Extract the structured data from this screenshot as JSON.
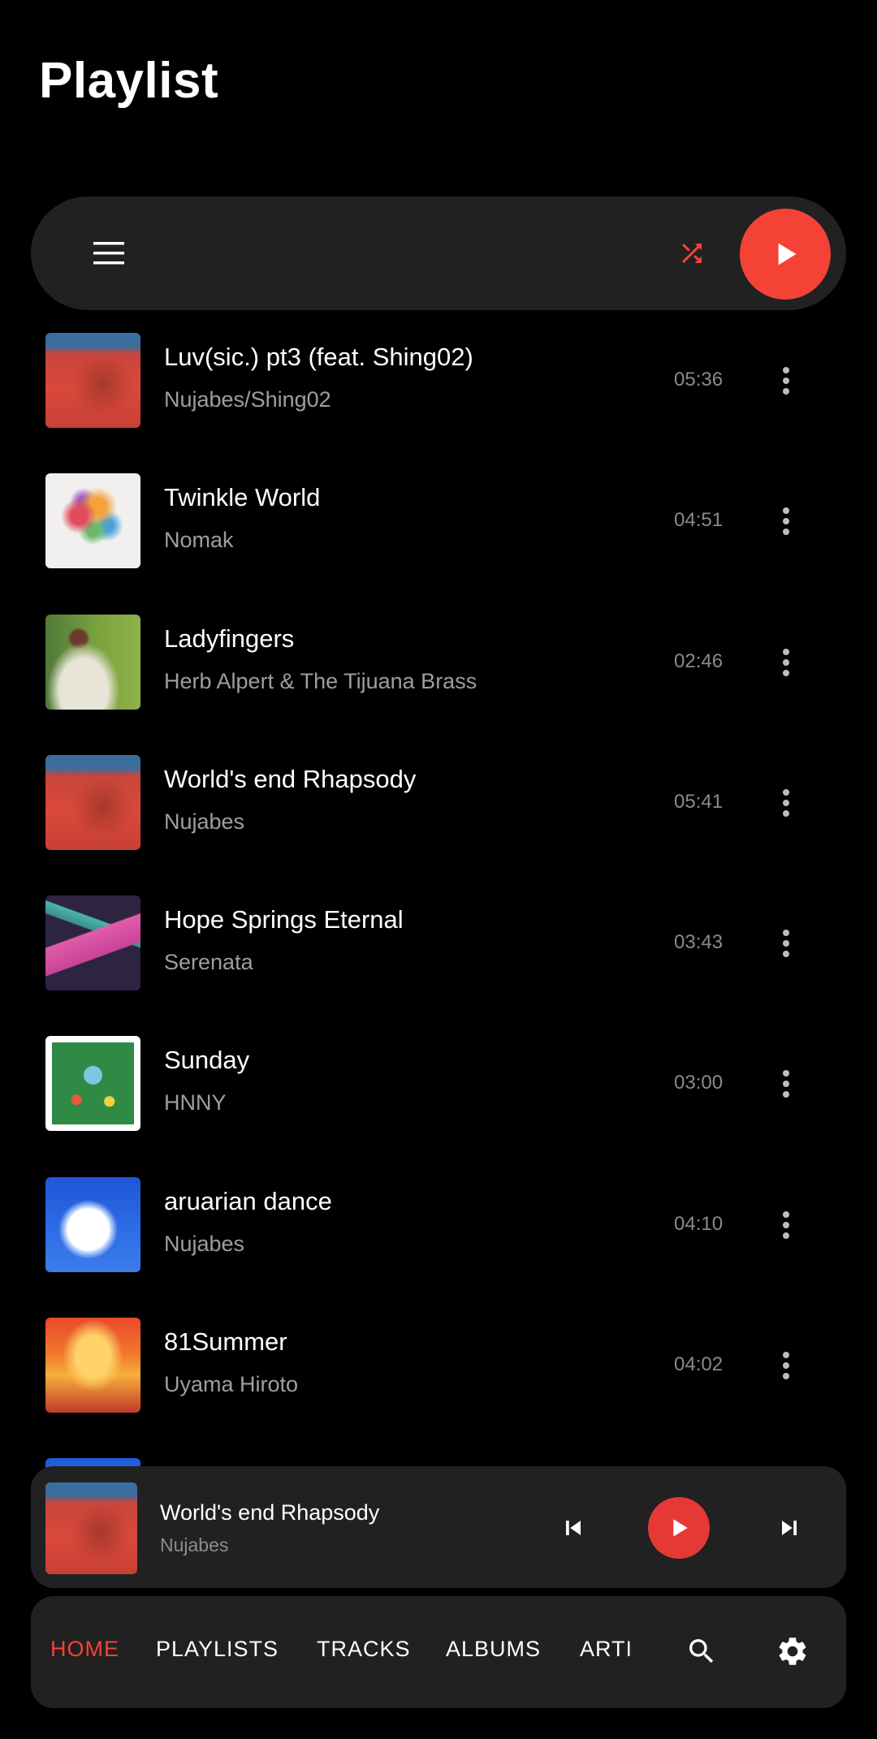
{
  "header": {
    "title": "Playlist"
  },
  "toolbar": {
    "menu_icon": "menu-icon",
    "shuffle_icon": "shuffle-icon",
    "play_icon": "play-icon",
    "accent_color": "#f44336"
  },
  "tracks": [
    {
      "title": "Luv(sic.) pt3 (feat. Shing02)",
      "artist": "Nujabes/Shing02",
      "duration": "05:36",
      "art": "modal-soul-cover"
    },
    {
      "title": "Twinkle World",
      "artist": "Nomak",
      "duration": "04:51",
      "art": "twinkle-world-cover"
    },
    {
      "title": "Ladyfingers",
      "artist": "Herb Alpert & The Tijuana Brass",
      "duration": "02:46",
      "art": "whipped-cream-cover"
    },
    {
      "title": "World's end Rhapsody",
      "artist": "Nujabes",
      "duration": "05:41",
      "art": "modal-soul-cover"
    },
    {
      "title": "Hope Springs Eternal",
      "artist": "Serenata",
      "duration": "03:43",
      "art": "serenata-cover"
    },
    {
      "title": "Sunday",
      "artist": "HNNY",
      "duration": "03:00",
      "art": "sunday-cover"
    },
    {
      "title": "aruarian dance",
      "artist": "Nujabes",
      "duration": "04:10",
      "art": "departure-cover"
    },
    {
      "title": "81Summer",
      "artist": "Uyama Hiroto",
      "duration": "04:02",
      "art": "81summer-cover"
    }
  ],
  "now_playing": {
    "title": "World's end Rhapsody",
    "artist": "Nujabes",
    "prev_icon": "skip-previous-icon",
    "play_icon": "play-icon",
    "next_icon": "skip-next-icon"
  },
  "bottom_nav": {
    "tabs": [
      {
        "label": "HOME",
        "active": true
      },
      {
        "label": "PLAYLISTS",
        "active": false
      },
      {
        "label": "TRACKS",
        "active": false
      },
      {
        "label": "ALBUMS",
        "active": false
      },
      {
        "label": "ARTI",
        "active": false
      }
    ],
    "search_icon": "search-icon",
    "settings_icon": "settings-gear-icon",
    "active_color": "#f44336"
  }
}
